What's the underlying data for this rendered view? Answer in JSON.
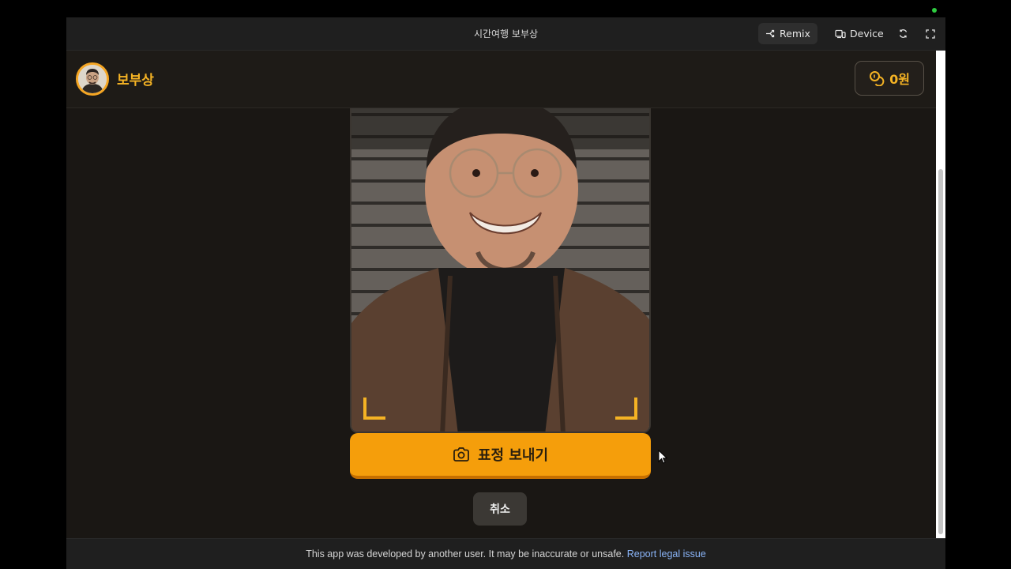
{
  "window": {
    "title": "시간여행 보부상",
    "remix_label": "Remix",
    "device_label": "Device"
  },
  "app": {
    "brand": "보부상",
    "coins": "0원",
    "send_button": "표정 보내기",
    "cancel_button": "취소"
  },
  "footer": {
    "notice": "This app was developed by another user. It may be inaccurate or unsafe.",
    "link": "Report legal issue"
  },
  "colors": {
    "accent": "#f5b324",
    "button": "#f59e0b",
    "background": "#1a1714"
  }
}
